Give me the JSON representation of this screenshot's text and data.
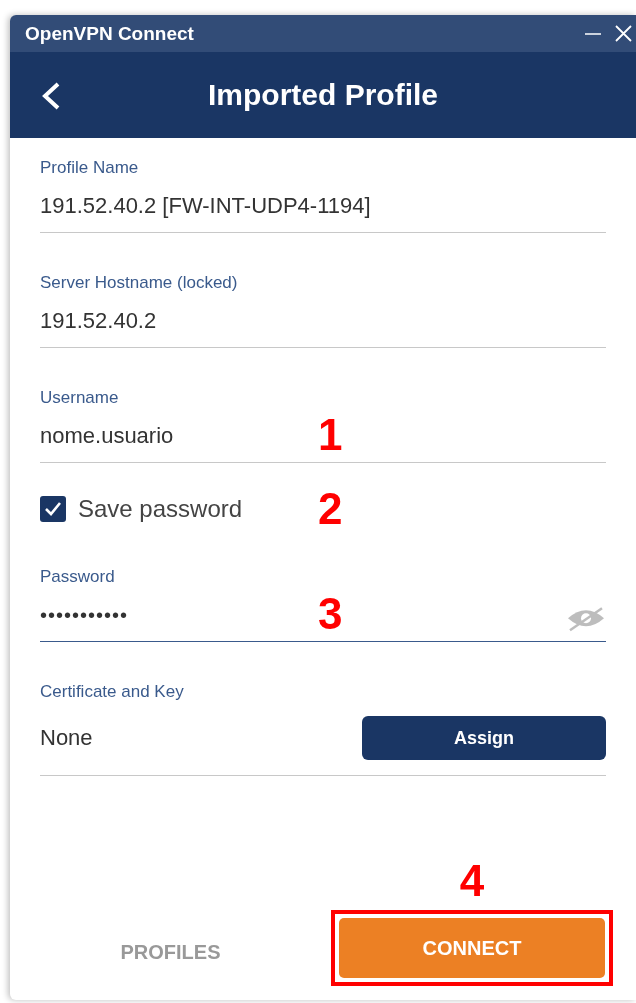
{
  "window": {
    "title": "OpenVPN Connect"
  },
  "header": {
    "title": "Imported Profile"
  },
  "fields": [
    {
      "kind": "text",
      "label": "Profile Name",
      "value": "191.52.40.2 [FW-INT-UDP4-1194]"
    },
    {
      "kind": "text",
      "label": "Server Hostname (locked)",
      "value": "191.52.40.2"
    },
    {
      "kind": "text",
      "label": "Username",
      "value": "nome.usuario",
      "marker": "1"
    },
    {
      "kind": "checkbox",
      "label": "Save password",
      "checked": true,
      "marker": "2"
    },
    {
      "kind": "password",
      "label": "Password",
      "value": "•••••••••••",
      "focused": true,
      "marker": "3"
    },
    {
      "kind": "assign",
      "label": "Certificate and Key",
      "value": "None",
      "button": "Assign"
    }
  ],
  "footer": {
    "profiles": "PROFILES",
    "connect": "CONNECT",
    "connect_marker": "4",
    "connect_highlighted": true
  }
}
